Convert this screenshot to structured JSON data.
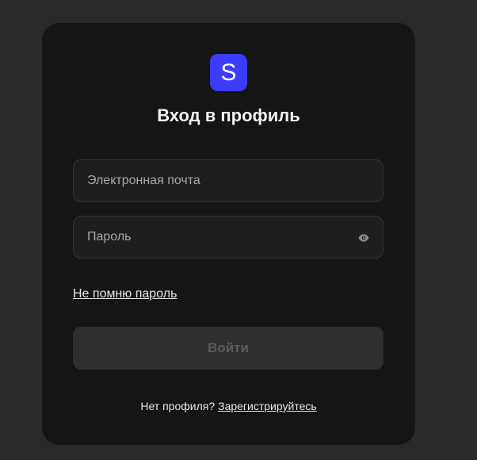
{
  "logo": {
    "letter": "S",
    "color": "#3b3dfa"
  },
  "title": "Вход в профиль",
  "email": {
    "placeholder": "Электронная почта",
    "value": ""
  },
  "password": {
    "placeholder": "Пароль",
    "value": "",
    "toggle_icon": "eye-icon"
  },
  "forgot_link": "Не помню пароль",
  "login_button": "Войти",
  "register": {
    "prompt": "Нет профиля?",
    "link": "Зарегистрируйтесь"
  }
}
